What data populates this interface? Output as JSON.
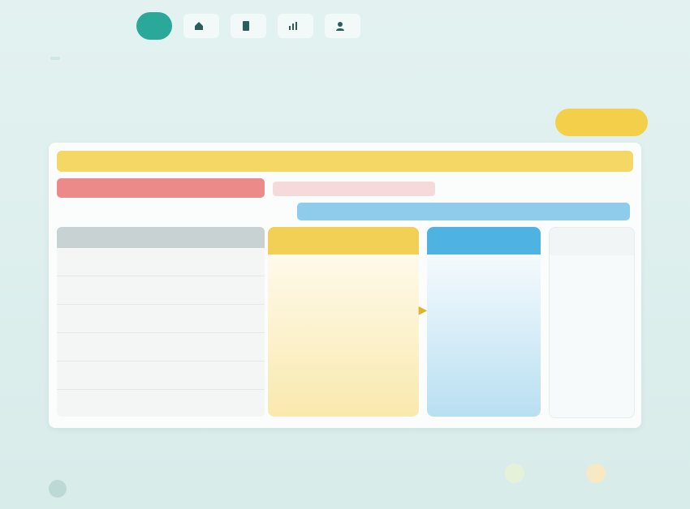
{
  "nav": {
    "active": "",
    "items": [
      {
        "icon": "home-icon",
        "label": ""
      },
      {
        "icon": "document-icon",
        "label": ""
      },
      {
        "icon": "chart-icon",
        "label": ""
      },
      {
        "icon": "user-icon",
        "label": ""
      }
    ]
  },
  "header": {
    "kicker": "",
    "headline": "",
    "cta": ""
  },
  "card": {
    "banner": "",
    "red_label": "",
    "pink_label": "",
    "blue_label": "",
    "table": {
      "headers": [
        "",
        "",
        ""
      ],
      "rows": [
        [
          "",
          "",
          ""
        ],
        [
          "",
          "",
          ""
        ],
        [
          "",
          "",
          ""
        ],
        [
          "",
          "",
          ""
        ],
        [
          "",
          "",
          ""
        ],
        [
          "",
          "",
          ""
        ]
      ]
    },
    "col_yellow": {
      "title": "",
      "items": [
        "",
        "",
        "",
        ""
      ]
    },
    "col_blue": {
      "title": "",
      "items": [
        "",
        "",
        "",
        ""
      ]
    },
    "col_white": {
      "title": "",
      "items": [
        "",
        "",
        "",
        ""
      ]
    }
  },
  "footer": {
    "logo": "",
    "tag1": "",
    "tag2": ""
  },
  "colors": {
    "accent": "#2aa89a",
    "yellow": "#f2cf55",
    "blue": "#4fb3e2",
    "red": "#ec8989"
  }
}
